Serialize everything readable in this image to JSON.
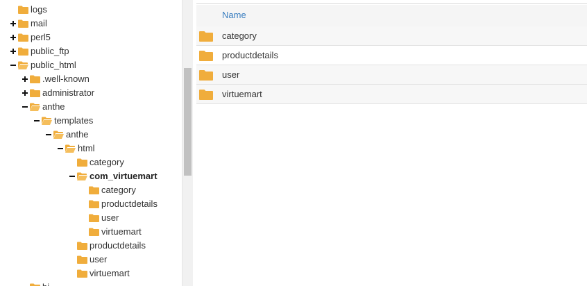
{
  "colors": {
    "folder": "#f0ad3c",
    "link": "#3a7ec0",
    "scroll_thumb": "#c1c1c1"
  },
  "tree": {
    "items": [
      {
        "label": "logs",
        "toggle": "none"
      },
      {
        "label": "mail",
        "toggle": "plus"
      },
      {
        "label": "perl5",
        "toggle": "plus"
      },
      {
        "label": "public_ftp",
        "toggle": "plus"
      },
      {
        "label": "public_html",
        "toggle": "minus"
      },
      {
        "label": ".well-known",
        "toggle": "plus"
      },
      {
        "label": "administrator",
        "toggle": "plus"
      },
      {
        "label": "anthe",
        "toggle": "minus"
      },
      {
        "label": "templates",
        "toggle": "minus"
      },
      {
        "label": "anthe",
        "toggle": "minus"
      },
      {
        "label": "html",
        "toggle": "minus"
      },
      {
        "label": "category",
        "toggle": "none"
      },
      {
        "label": "com_virtuemart",
        "toggle": "minus",
        "selected": true
      },
      {
        "label": "category",
        "toggle": "none"
      },
      {
        "label": "productdetails",
        "toggle": "none"
      },
      {
        "label": "user",
        "toggle": "none"
      },
      {
        "label": "virtuemart",
        "toggle": "none"
      },
      {
        "label": "productdetails",
        "toggle": "none"
      },
      {
        "label": "user",
        "toggle": "none"
      },
      {
        "label": "virtuemart",
        "toggle": "none"
      },
      {
        "label": "bi",
        "toggle": "none"
      }
    ]
  },
  "file_list": {
    "header": {
      "name": "Name"
    },
    "rows": [
      {
        "name": "category",
        "icon": "folder-icon"
      },
      {
        "name": "productdetails",
        "icon": "folder-icon"
      },
      {
        "name": "user",
        "icon": "folder-icon"
      },
      {
        "name": "virtuemart",
        "icon": "folder-icon"
      }
    ]
  }
}
